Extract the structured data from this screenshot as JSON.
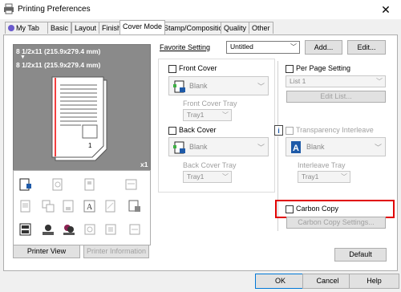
{
  "window": {
    "title": "Printing Preferences",
    "close": "✕"
  },
  "tabs": [
    "My Tab",
    "Basic",
    "Layout",
    "Finish",
    "Cover Mode",
    "Stamp/Composition",
    "Quality",
    "Other"
  ],
  "preview": {
    "line1": "8 1/2x11 (215.9x279.4 mm)",
    "arrow": "▼",
    "line2": "8 1/2x11 (215.9x279.4 mm)",
    "copies": "x1"
  },
  "favorite": {
    "label": "Favorite Setting",
    "value": "Untitled",
    "add": "Add...",
    "edit": "Edit..."
  },
  "front_cover": {
    "label": "Front Cover",
    "value": "Blank",
    "tray_label": "Front Cover Tray",
    "tray_value": "Tray1"
  },
  "back_cover": {
    "label": "Back Cover",
    "value": "Blank",
    "tray_label": "Back Cover Tray",
    "tray_value": "Tray1"
  },
  "per_page": {
    "label": "Per Page Setting",
    "list_value": "List 1",
    "edit_list": "Edit List..."
  },
  "transparency": {
    "label": "Transparency Interleave",
    "value": "Blank",
    "tray_label": "Interleave Tray",
    "tray_value": "Tray1"
  },
  "carbon": {
    "label": "Carbon Copy",
    "settings": "Carbon Copy Settings..."
  },
  "buttons": {
    "printer_view": "Printer View",
    "printer_info": "Printer Information",
    "default": "Default",
    "ok": "OK",
    "cancel": "Cancel",
    "help": "Help"
  },
  "info_icon_glyph": "i"
}
